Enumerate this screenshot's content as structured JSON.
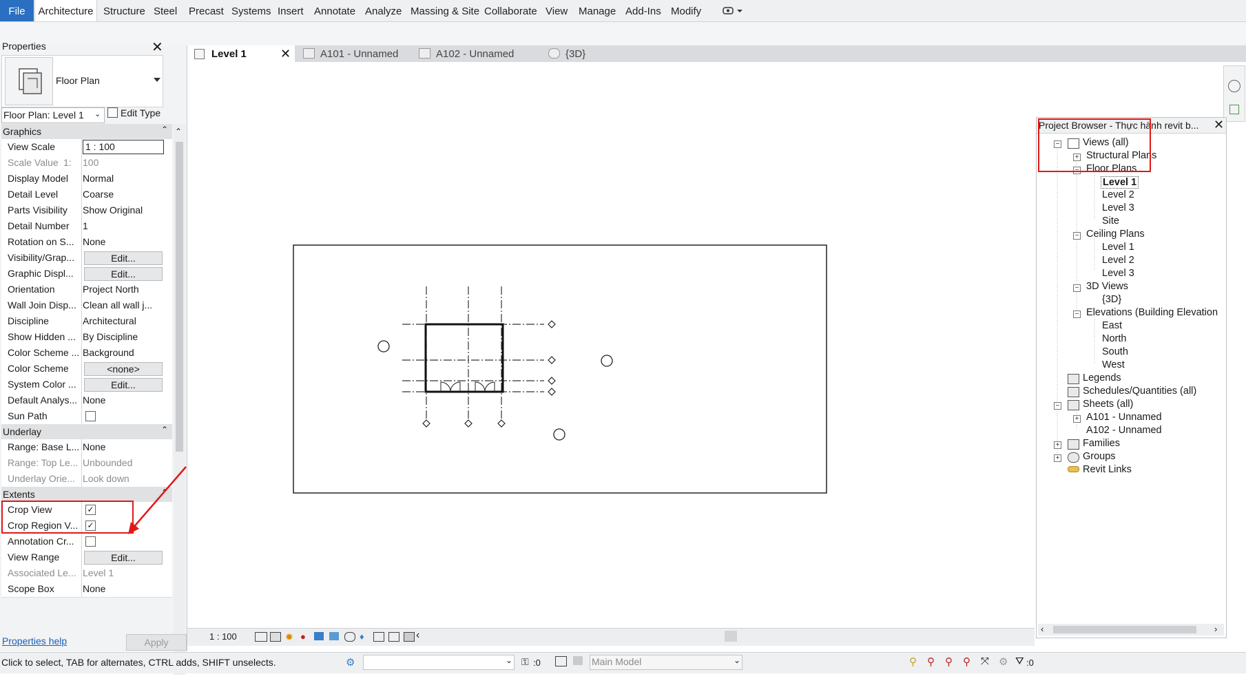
{
  "ribbon": {
    "tabs": [
      "File",
      "Architecture",
      "Structure",
      "Steel",
      "Precast",
      "Systems",
      "Insert",
      "Annotate",
      "Analyze",
      "Massing & Site",
      "Collaborate",
      "View",
      "Manage",
      "Add-Ins",
      "Modify"
    ],
    "active": "Architecture"
  },
  "properties": {
    "title": "Properties",
    "type_name": "Floor Plan",
    "instance_selector": "Floor Plan: Level 1",
    "edit_type": "Edit Type",
    "sections": {
      "graphics": "Graphics",
      "underlay": "Underlay",
      "extents": "Extents"
    },
    "graphics_rows": [
      {
        "name": "View Scale",
        "value": "1 : 100"
      },
      {
        "name": "Scale Value",
        "prefix": "1:",
        "value": "100"
      },
      {
        "name": "Display Model",
        "value": "Normal"
      },
      {
        "name": "Detail Level",
        "value": "Coarse"
      },
      {
        "name": "Parts Visibility",
        "value": "Show Original"
      },
      {
        "name": "Detail Number",
        "value": "1"
      },
      {
        "name": "Rotation on S...",
        "value": "None"
      },
      {
        "name": "Visibility/Grap...",
        "value": "Edit..."
      },
      {
        "name": "Graphic Displ...",
        "value": "Edit..."
      },
      {
        "name": "Orientation",
        "value": "Project North"
      },
      {
        "name": "Wall Join Disp...",
        "value": "Clean all wall j..."
      },
      {
        "name": "Discipline",
        "value": "Architectural"
      },
      {
        "name": "Show Hidden ...",
        "value": "By Discipline"
      },
      {
        "name": "Color Scheme ...",
        "value": "Background"
      },
      {
        "name": "Color Scheme",
        "value": "<none>"
      },
      {
        "name": "System Color ...",
        "value": "Edit..."
      },
      {
        "name": "Default Analys...",
        "value": "None"
      },
      {
        "name": "Sun Path",
        "value": ""
      }
    ],
    "underlay_rows": [
      {
        "name": "Range: Base L...",
        "value": "None"
      },
      {
        "name": "Range: Top Le...",
        "value": "Unbounded"
      },
      {
        "name": "Underlay Orie...",
        "value": "Look down"
      }
    ],
    "extents_rows": [
      {
        "name": "Crop View",
        "value": "✓"
      },
      {
        "name": "Crop Region V...",
        "value": "✓"
      },
      {
        "name": "Annotation Cr...",
        "value": ""
      },
      {
        "name": "View Range",
        "value": "Edit..."
      },
      {
        "name": "Associated Le...",
        "value": "Level 1"
      },
      {
        "name": "Scope Box",
        "value": "None"
      }
    ],
    "help_link": "Properties help",
    "apply": "Apply"
  },
  "view_tabs": [
    {
      "label": "Level 1"
    },
    {
      "label": "A101 - Unnamed"
    },
    {
      "label": "A102 - Unnamed"
    },
    {
      "label": "{3D}"
    }
  ],
  "project_browser": {
    "title": "Project Browser - Thực hành revit b...",
    "items": {
      "views_all": "Views (all)",
      "structural_plans": "Structural Plans",
      "floor_plans": "Floor Plans",
      "fp_level1": "Level 1",
      "fp_level2": "Level 2",
      "fp_level3": "Level 3",
      "fp_site": "Site",
      "ceiling_plans": "Ceiling Plans",
      "cp_level1": "Level 1",
      "cp_level2": "Level 2",
      "cp_level3": "Level 3",
      "views_3d": "3D Views",
      "v3d": "{3D}",
      "elevations": "Elevations (Building Elevation",
      "east": "East",
      "north": "North",
      "south": "South",
      "west": "West",
      "legends": "Legends",
      "schedules": "Schedules/Quantities (all)",
      "sheets": "Sheets (all)",
      "a101": "A101 - Unnamed",
      "a102": "A102 - Unnamed",
      "families": "Families",
      "groups": "Groups",
      "revit_links": "Revit Links"
    }
  },
  "view_control_bar": {
    "scale": "1 : 100"
  },
  "status_bar": {
    "message": "Click to select, TAB for alternates, CTRL adds, SHIFT unselects.",
    "count_a": ":0",
    "model": "Main Model",
    "filter_count": ":0"
  },
  "colors": {
    "highlight": "#e01818",
    "file_tab": "#2a6fc1"
  }
}
